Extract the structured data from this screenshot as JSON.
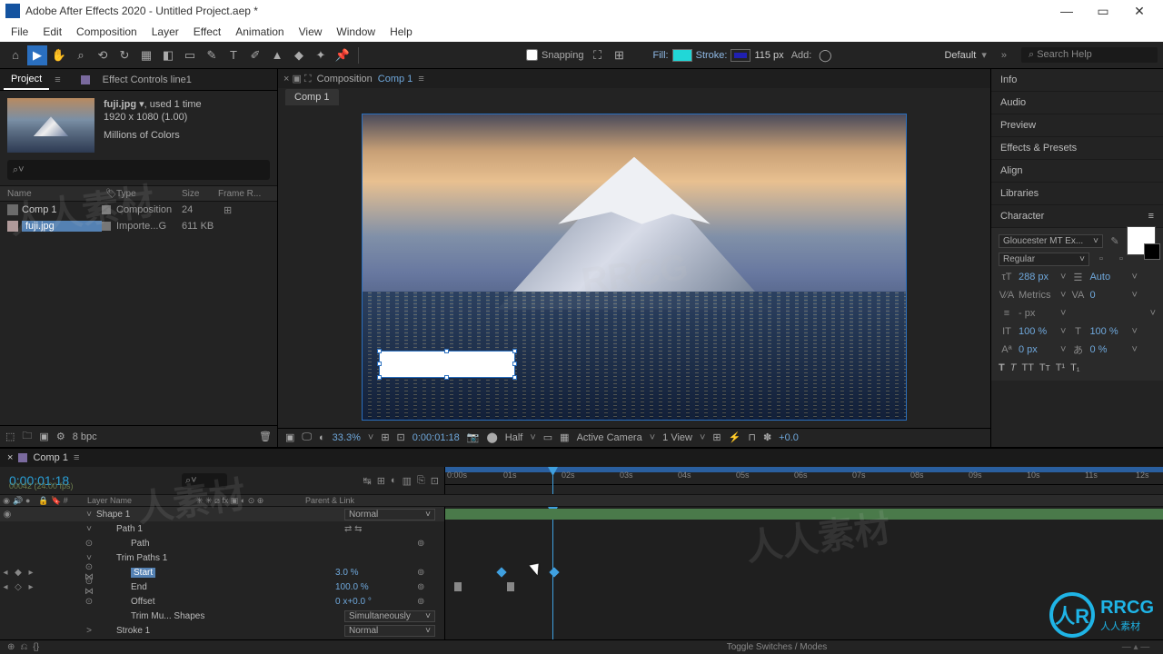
{
  "titlebar": {
    "title": "Adobe After Effects 2020 - Untitled Project.aep *"
  },
  "menu": [
    "File",
    "Edit",
    "Composition",
    "Layer",
    "Effect",
    "Animation",
    "View",
    "Window",
    "Help"
  ],
  "toolbar": {
    "snapping": "Snapping",
    "fill": "Fill:",
    "stroke": "Stroke:",
    "stroke_px": "115 px",
    "add": "Add:",
    "workspace": "Default",
    "search_placeholder": "Search Help"
  },
  "project": {
    "tab_project": "Project",
    "tab_effect": "Effect Controls line1",
    "file_name": "fuji.jpg",
    "used": ", used 1 time",
    "dims": "1920 x 1080 (1.00)",
    "colors": "Millions of Colors",
    "search_ph": "⌕",
    "headers": {
      "name": "Name",
      "type": "Type",
      "size": "Size",
      "fr": "Frame R..."
    },
    "rows": [
      {
        "name": "Comp 1",
        "type": "Composition",
        "size": "24"
      },
      {
        "name": "fuji.jpg",
        "type": "Importe...G",
        "size": "611 KB"
      }
    ],
    "bpc": "8 bpc"
  },
  "comp": {
    "panel": "Composition",
    "active": "Comp 1",
    "tab": "Comp 1",
    "footer": {
      "zoom": "33.3%",
      "time": "0:00:01:18",
      "res": "Half",
      "camera": "Active Camera",
      "view": "1 View",
      "exp": "+0.0"
    }
  },
  "right": {
    "items": [
      "Info",
      "Audio",
      "Preview",
      "Effects & Presets",
      "Align",
      "Libraries",
      "Character"
    ],
    "char": {
      "font": "Gloucester MT Ex...",
      "style": "Regular",
      "size": "288 px",
      "leading": "Auto",
      "kerning": "Metrics",
      "tracking": "0",
      "stroke": "- px",
      "vscale": "100 %",
      "hscale": "100 %",
      "baseline": "0 px",
      "tsume": "0 %"
    }
  },
  "timeline": {
    "tab": "Comp 1",
    "timecode": "0:00:01:18",
    "fps": "00042 (24.00 fps)",
    "cols": {
      "layer": "Layer Name",
      "parent": "Parent & Link"
    },
    "ruler": [
      "0:00s",
      "01s",
      "02s",
      "03s",
      "04s",
      "05s",
      "06s",
      "07s",
      "08s",
      "09s",
      "10s",
      "11s",
      "12s"
    ],
    "layers": {
      "shape": "Shape 1",
      "path1": "Path 1",
      "path": "Path",
      "trim": "Trim Paths 1",
      "start": "Start",
      "start_val": "3.0 %",
      "end": "End",
      "end_val": "100.0 %",
      "offset": "Offset",
      "offset_val": "0 x+0.0 °",
      "trimmu": "Trim Mu... Shapes",
      "simul": "Simultaneously",
      "stroke1": "Stroke 1",
      "normal": "Normal"
    },
    "toggle": "Toggle Switches / Modes"
  }
}
